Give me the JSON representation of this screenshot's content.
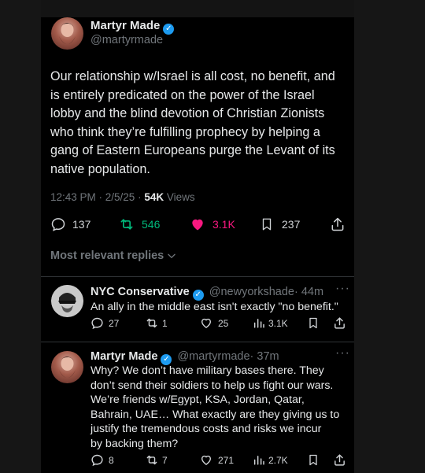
{
  "main_tweet": {
    "author_name": "Martyr Made",
    "author_handle": "@martyrmade",
    "text_lines": [
      "Our relationship w/Israel is all cost, no benefit, and",
      "is entirely predicated on the power of the Israel",
      "lobby and the blind devotion of Christian Zionists",
      "who think they’re fulfilling prophecy by helping a",
      "gang of Eastern Europeans purge the Levant of its",
      "native population."
    ],
    "time": "12:43 PM · 2/5/25 · ",
    "views_count": "54K",
    "views_label": " Views",
    "replies": "137",
    "reposts": "546",
    "likes": "3.1K",
    "bookmarks": "237"
  },
  "sort_label": "Most relevant replies",
  "replies": [
    {
      "author_name": "NYC Conservative",
      "author_handle": "@newyorkshade",
      "time": "· 44m",
      "text_lines": [
        "An ally in the middle east isn't exactly \"no benefit.\""
      ],
      "replies": "27",
      "reposts": "1",
      "likes": "25",
      "views": "3.1K"
    },
    {
      "author_name": "Martyr Made",
      "author_handle": "@martyrmade",
      "time": "· 37m",
      "text_lines": [
        "Why? We don’t have military bases there. They",
        "don’t send their soldiers to help us fight our wars.",
        "We’re friends w/Egypt, KSA, Jordan, Qatar,",
        "Bahrain, UAE… What exactly are they giving us to",
        "justify the tremendous costs and risks we incur",
        "by backing them?"
      ],
      "replies": "8",
      "reposts": "7",
      "likes": "271",
      "views": "2.7K"
    }
  ],
  "colors": {
    "like_active": "#f91880",
    "repost_active": "#00ba7c",
    "verified": "#1d9bf0",
    "muted": "#71767b"
  },
  "icons": [
    "reply-icon",
    "repost-icon",
    "heart-icon",
    "bookmark-icon",
    "share-icon",
    "views-icon",
    "more-icon",
    "verified-icon",
    "chevron-down-icon"
  ]
}
